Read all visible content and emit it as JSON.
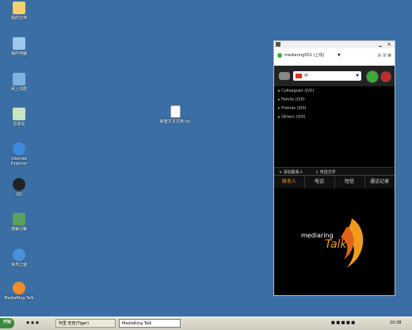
{
  "desktop": {
    "icons": [
      {
        "label": "我的文档",
        "icon": "documents-icon",
        "color": "#f1d36b"
      },
      {
        "label": "我的电脑",
        "icon": "computer-icon",
        "color": "#9fc7ec"
      },
      {
        "label": "网上邻居",
        "icon": "network-icon",
        "color": "#7fb2e0"
      },
      {
        "label": "回收站",
        "icon": "recycle-bin-icon",
        "color": "#c9e5c0"
      },
      {
        "label": "Internet Explorer",
        "icon": "ie-icon",
        "color": "#3d8be0"
      },
      {
        "label": "QQ",
        "icon": "qq-penguin-icon",
        "color": "#222222"
      },
      {
        "label": "搜索引擎",
        "icon": "search-engine-icon",
        "color": "#5aa05a"
      },
      {
        "label": "世界之窗",
        "icon": "browser-icon",
        "color": "#4a90d9"
      },
      {
        "label": "MediaRing Talk",
        "icon": "mediaring-icon",
        "color": "#f28c28"
      }
    ],
    "file": {
      "label": "新建文本文档.txt",
      "icon": "text-file-icon"
    }
  },
  "mediaring": {
    "status_user": "mediaring001 (上线)",
    "country_code": "中",
    "groups": [
      "Colleagues (0/0)",
      "Family (0/0)",
      "Friends (0/0)",
      "Others (0/0)"
    ],
    "add_contact": "添加联系人",
    "send_file": "传送文件",
    "tabs": [
      "联系人",
      "电话",
      "短信",
      "通话记录"
    ],
    "brand_top": "mediaring",
    "brand_bottom": "Talk"
  },
  "taskbar": {
    "start_label": "开始",
    "buttons": [
      "阿里 旺旺(Tiger)",
      "MediaRing Talk"
    ],
    "clock": "10:38"
  },
  "colors": {
    "desktop": "#3a6ea5",
    "accent": "#f39a1e",
    "call_green": "#3cab3c",
    "call_red": "#c62828"
  }
}
